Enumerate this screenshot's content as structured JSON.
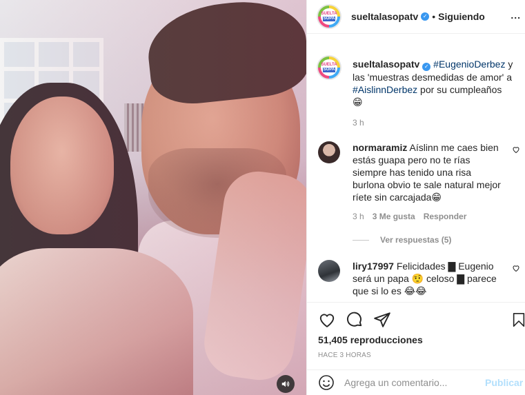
{
  "post": {
    "username": "sueltalasopatv",
    "follow_sep": "•",
    "follow_label": "Siguiendo",
    "more_label": "...",
    "avatar_line1": "SUELTA",
    "avatar_line2": "SOPA"
  },
  "caption": {
    "username": "sueltalasopatv",
    "hashtag1": "#EugenioDerbez",
    "text1": " y las 'muestras desmedidas de amor' a ",
    "hashtag2": "#AislinnDerbez",
    "text2": " por su cumpleaños",
    "emoji": "😁",
    "time": "3 h"
  },
  "comments": [
    {
      "username": "normaramiz",
      "text": "Aíslinn me caes bien estás guapa pero no te rías siempre has tenido una risa burlona obvio te sale natural mejor ríete sin carcajada😁",
      "time": "3 h",
      "likes": "3 Me gusta",
      "reply": "Responder"
    },
    {
      "username": "liry17997",
      "text": "Felicidades ▇ Eugenio será un papa 🤨 celoso ▇ parece que si lo es 😂😂",
      "time": "",
      "likes": "",
      "reply": ""
    }
  ],
  "replies_label": "Ver respuestas (5)",
  "views": "51,405 reproducciones",
  "ago": "HACE 3 HORAS",
  "comment_input": {
    "placeholder": "Agrega un comentario...",
    "publish": "Publicar"
  },
  "icons": {
    "like": "heart-icon",
    "comment": "comment-icon",
    "share": "send-icon",
    "save": "bookmark-icon",
    "sound": "volume-icon",
    "emoji": "emoji-icon"
  },
  "colors": {
    "verified": "#3897f0",
    "hashtag": "#003569",
    "publish_disabled": "#b2dffc"
  }
}
